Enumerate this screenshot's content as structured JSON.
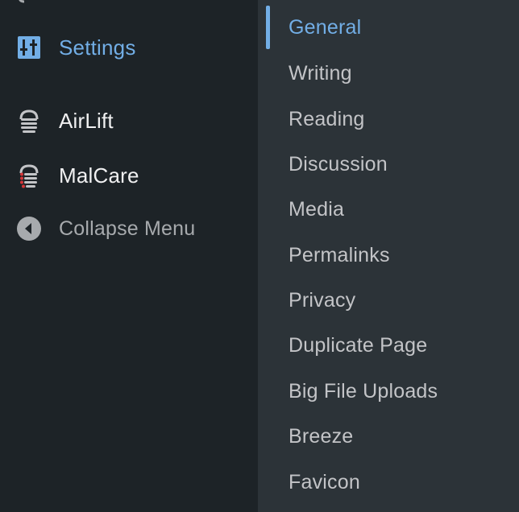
{
  "main_menu": {
    "items": [
      {
        "id": "settings",
        "label": "Settings",
        "icon": "settings-sliders-icon",
        "state": "active"
      },
      {
        "id": "airlift",
        "label": "AirLift",
        "icon": "airlift-plugin-icon"
      },
      {
        "id": "malcare",
        "label": "MalCare",
        "icon": "malcare-plugin-icon"
      }
    ],
    "collapse": {
      "label": "Collapse Menu",
      "icon": "collapse-arrow-icon"
    }
  },
  "submenu": {
    "current": "General",
    "items": [
      "General",
      "Writing",
      "Reading",
      "Discussion",
      "Media",
      "Permalinks",
      "Privacy",
      "Duplicate Page",
      "Big File Uploads",
      "Breeze",
      "Favicon"
    ]
  },
  "colors": {
    "sidebar_bg": "#1d2327",
    "submenu_bg": "#2c3338",
    "accent": "#72aee6",
    "text": "#f0f0f1",
    "muted": "#a7aaad"
  }
}
